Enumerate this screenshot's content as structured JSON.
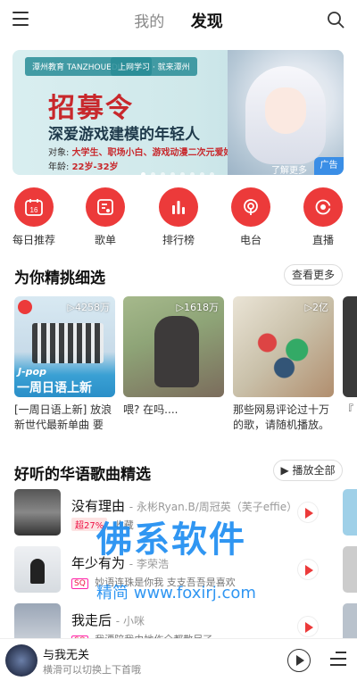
{
  "header": {
    "tabs": [
      {
        "label": "我的",
        "active": false
      },
      {
        "label": "发现",
        "active": true
      }
    ]
  },
  "banner": {
    "logo_text": "潭州教育 TANZHOUEDU.COM",
    "slogan": "上网学习 · 就来潭州",
    "title": "招募令",
    "subtitle": "深爱游戏建模的年轻人",
    "target_label": "对象:",
    "target_value": "大学生、职场小白、游戏动漫二次元爱好者",
    "age_label": "年龄:",
    "age_value": "22岁-32岁",
    "more_label": "了解更多",
    "ad_label": "广告",
    "dot_count": 8,
    "active_dot": 0
  },
  "quick_nav": [
    {
      "label": "每日推荐",
      "icon": "calendar-icon",
      "calendar_day": "16"
    },
    {
      "label": "歌单",
      "icon": "playlist-icon"
    },
    {
      "label": "排行榜",
      "icon": "chart-icon"
    },
    {
      "label": "电台",
      "icon": "radio-icon"
    },
    {
      "label": "直播",
      "icon": "live-icon"
    }
  ],
  "featured": {
    "title": "为你精挑细选",
    "more_label": "查看更多",
    "cards": [
      {
        "plays": "▷4258万",
        "cover_title": "一周日语上新",
        "cover_tag": "J-pop",
        "desc": "[一周日语上新] 放浪新世代最新单曲 要做..."
      },
      {
        "plays": "▷1618万",
        "desc": "喂? 在吗...."
      },
      {
        "plays": "▷2亿",
        "desc": "那些网易评论过十万的歌，请随机播放。"
      },
      {
        "plays": "",
        "desc": "『"
      }
    ]
  },
  "songs_section": {
    "title": "好听的华语歌曲精选",
    "play_all_label": "▶ 播放全部",
    "songs": [
      {
        "title": "没有理由",
        "artist": "- 永彬Ryan.B/周冠英（芙子effie）",
        "hot": "超27%",
        "meta": "收藏"
      },
      {
        "title": "年少有为",
        "artist": "- 李荣浩",
        "badge": "SQ",
        "meta": "妙语连珠是你我 支支吾吾是喜欢"
      },
      {
        "title": "我走后",
        "artist": "- 小咪",
        "badge": "SQ",
        "meta": "我湮陪我由她作全都散尽了"
      }
    ]
  },
  "watermark": {
    "text": "佛系软件",
    "url": "精简 www.foxirj.com"
  },
  "player": {
    "title": "与我无关",
    "subtitle": "横滑可以切换上下首哦"
  },
  "colors": {
    "accent": "#ec3a3a",
    "watermark": "#1f8ef1",
    "ad_badge": "#3a8ee6"
  }
}
